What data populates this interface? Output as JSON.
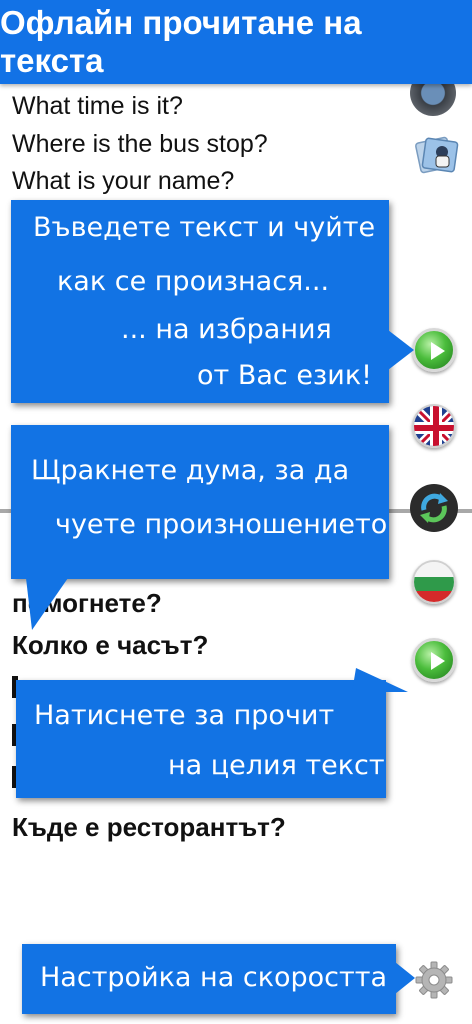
{
  "header": {
    "title": "Офлайн прочитане на текста"
  },
  "source_text": {
    "lines": [
      "What time is it?",
      "Where is the bus stop?",
      "What is your name?"
    ]
  },
  "target_text": {
    "lines": [
      "помогнете?",
      "Колко е часът?",
      "Къде е ресторантът?"
    ]
  },
  "callouts": {
    "enter_text": [
      "Въведете текст и чуйте",
      "как се произнася...",
      "... на избрания",
      "от Вас език!"
    ],
    "click_word": [
      "Щракнете дума, за да",
      "чуете произношението"
    ],
    "read_all": [
      "Натиснете за прочит",
      "на целия текст"
    ],
    "speed": [
      "Настройка на скоростта"
    ]
  },
  "icons": {
    "play_top": "play-icon",
    "flag_uk": "uk-flag-icon",
    "swap": "swap-languages-icon",
    "flag_bg": "bulgaria-flag-icon",
    "play_bottom": "play-icon",
    "settings": "gear-icon",
    "photo": "photo-gallery-icon",
    "record": "record-icon"
  },
  "colors": {
    "accent": "#1272e6"
  }
}
